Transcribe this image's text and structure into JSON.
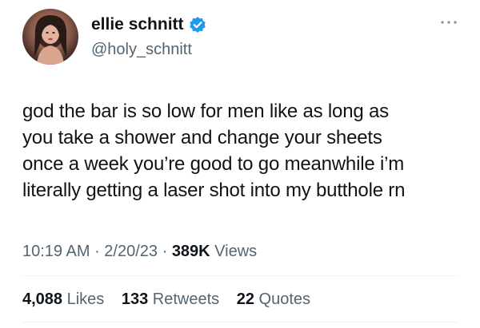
{
  "author": {
    "display_name": "ellie schnitt",
    "handle": "@holy_schnitt",
    "verified_color": "#1d9bf0"
  },
  "icons": {
    "verified": "verified-badge-icon",
    "more": "more-options-icon"
  },
  "tweet": {
    "lines": [
      "god the bar is so low for men like as long as",
      "you take a shower and change your sheets",
      "once a week you’re good to go meanwhile i’m",
      "literally getting a laser shot into my butthole rn"
    ]
  },
  "meta": {
    "time": "10:19 AM",
    "sep1": " · ",
    "date": "2/20/23",
    "sep2": " · ",
    "views_count": "389K",
    "views_label": " Views"
  },
  "stats": {
    "likes_count": "4,088",
    "likes_label": " Likes",
    "retweets_count": "133",
    "retweets_label": " Retweets",
    "quotes_count": "22",
    "quotes_label": " Quotes"
  },
  "colors": {
    "text_primary": "#0f1419",
    "text_secondary": "#536471",
    "divider": "#eff3f4"
  }
}
